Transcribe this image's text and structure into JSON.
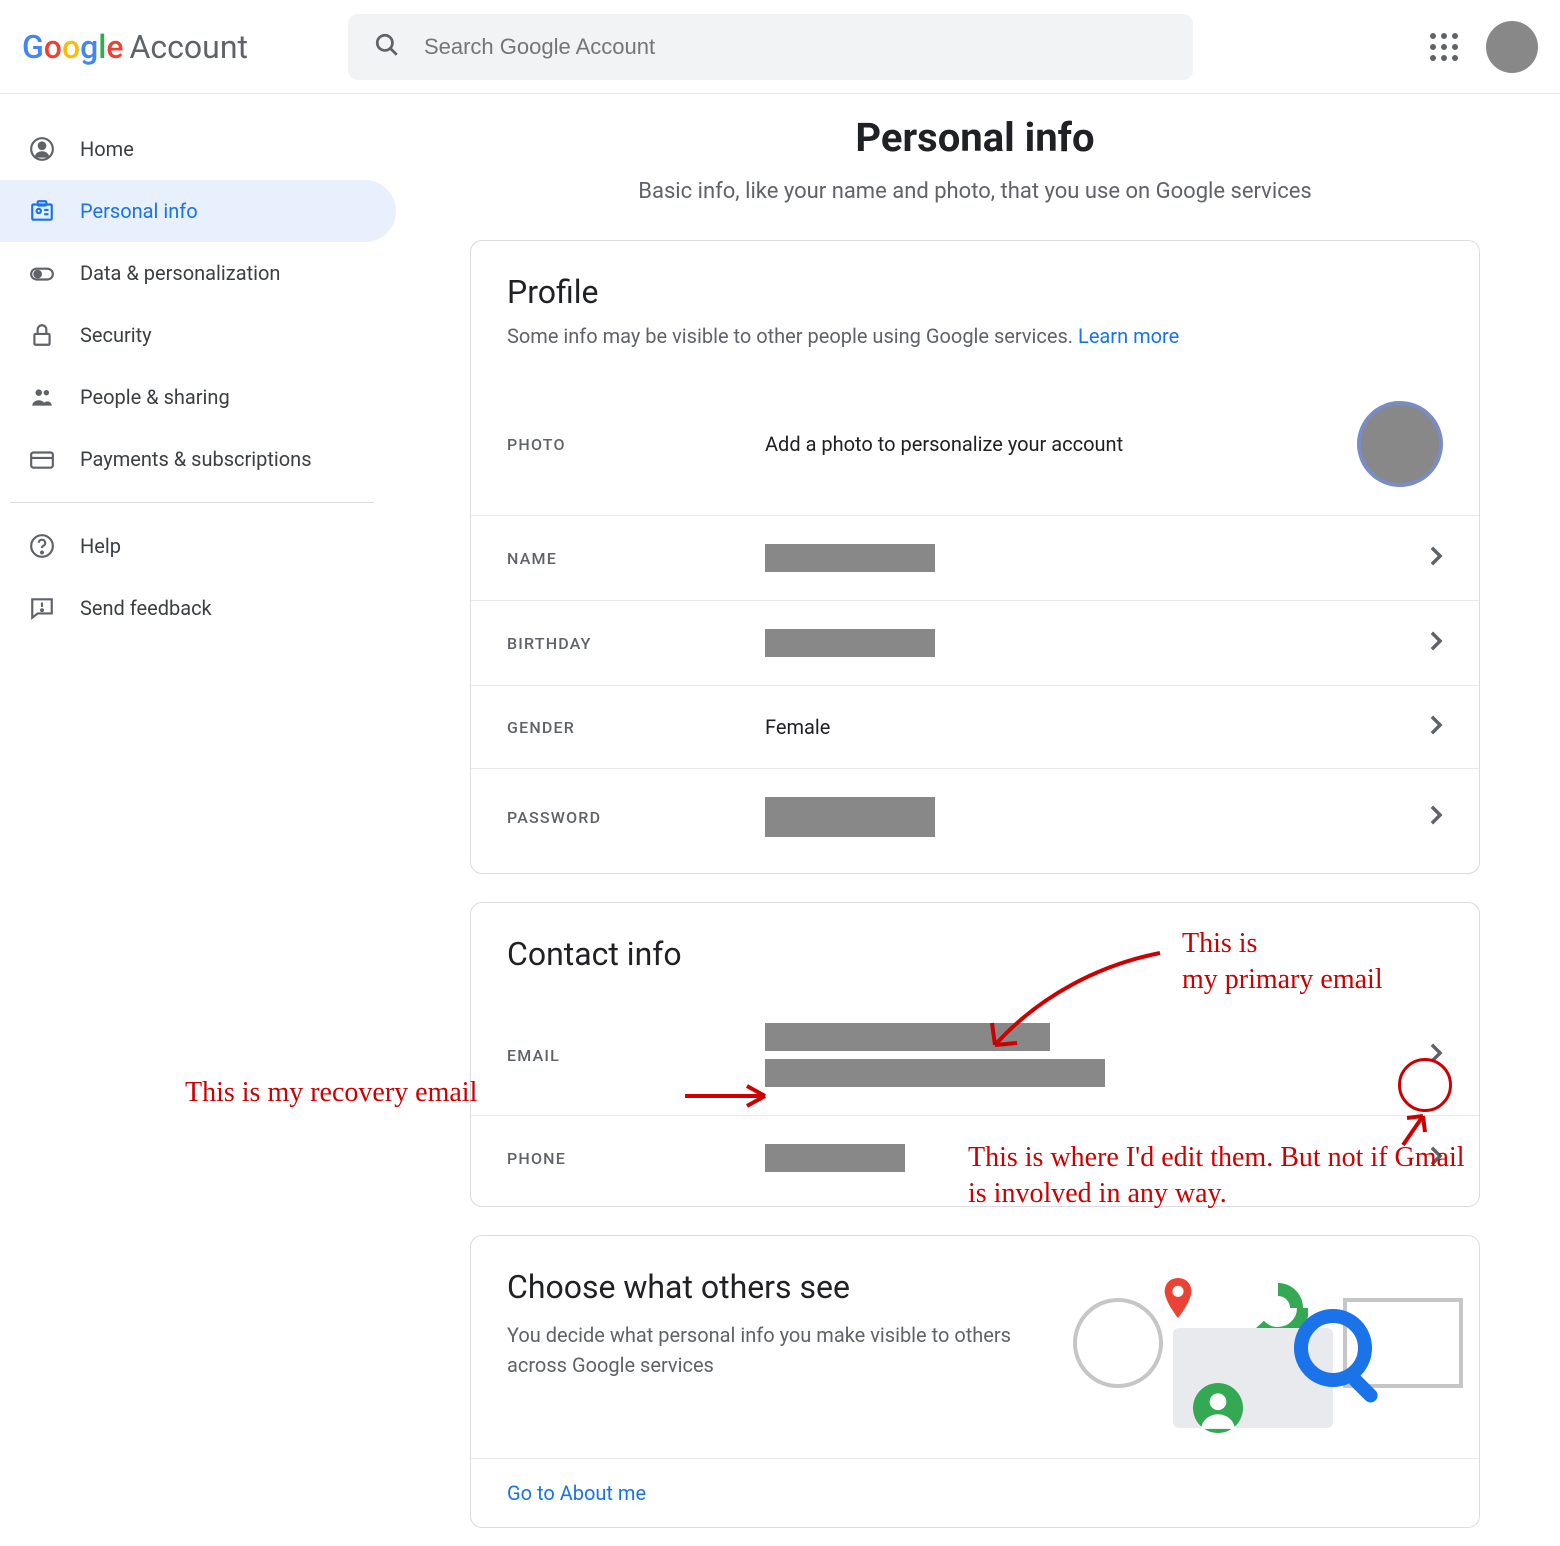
{
  "header": {
    "logo_account": "Account",
    "search_placeholder": "Search Google Account"
  },
  "sidebar": {
    "items": [
      {
        "label": "Home"
      },
      {
        "label": "Personal info"
      },
      {
        "label": "Data & personalization"
      },
      {
        "label": "Security"
      },
      {
        "label": "People & sharing"
      },
      {
        "label": "Payments & subscriptions"
      }
    ],
    "footer": [
      {
        "label": "Help"
      },
      {
        "label": "Send feedback"
      }
    ]
  },
  "page": {
    "title": "Personal info",
    "subtitle": "Basic info, like your name and photo, that you use on Google services"
  },
  "profile": {
    "title": "Profile",
    "subtext": "Some info may be visible to other people using Google services. ",
    "learn_more": "Learn more",
    "rows": {
      "photo_label": "PHOTO",
      "photo_value": "Add a photo to personalize your account",
      "name_label": "NAME",
      "birthday_label": "BIRTHDAY",
      "gender_label": "GENDER",
      "gender_value": "Female",
      "password_label": "PASSWORD"
    }
  },
  "contact": {
    "title": "Contact info",
    "email_label": "EMAIL",
    "phone_label": "PHONE"
  },
  "choose": {
    "title": "Choose what others see",
    "subtext": "You decide what personal info you make visible to others across Google services",
    "link": "Go to About me"
  },
  "annotations": {
    "primary": "This is\nmy primary email",
    "recovery": "This is my recovery email",
    "edit": "This is where I'd edit them. But not if Gmail is involved in any way."
  }
}
